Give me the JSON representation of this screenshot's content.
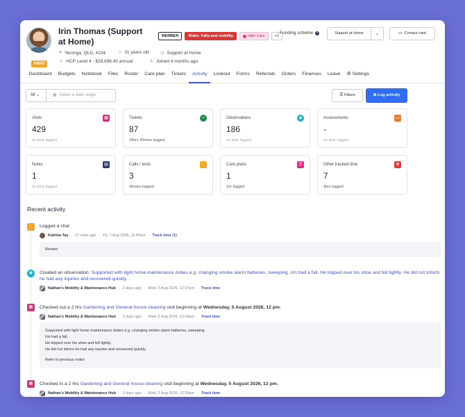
{
  "client": {
    "name": "Irin Thomas (Support at Home)",
    "status": "AWAY",
    "badges": {
      "member": "MEMBER",
      "risk": "Risks: Falls and mobility",
      "care": "High Care",
      "more": "+2"
    },
    "location": "Yeronga, QLD, 4104",
    "age": "31 years old",
    "program": "Support at Home",
    "funding_level": "HCP Level 4 - $29,696.40 annual",
    "joined": "Joined 4 months ago"
  },
  "header": {
    "funding_label": "Funding scheme",
    "funding_value": "Support at Home",
    "contact_button": "Contact card"
  },
  "tabs": [
    "Dashboard",
    "Budgets",
    "Notebook",
    "Files",
    "Roster",
    "Care plan",
    "Tickets",
    "Activity",
    "Lookout",
    "Forms",
    "Referrals",
    "Orders",
    "Finances",
    "Leave",
    "Settings"
  ],
  "active_tab": "Activity",
  "filters": {
    "all_label": "All",
    "date_placeholder": "Select a date range",
    "filters_button": "Filters",
    "log_button": "Log activity"
  },
  "stats": [
    {
      "label": "Visits",
      "value": "429",
      "sub": "no time logged",
      "color": "#d6317a",
      "icon": "calendar-icon"
    },
    {
      "label": "Tickets",
      "value": "87",
      "sub": "18hrs 30mins logged",
      "color": "#1f8a4c",
      "icon": "check-icon"
    },
    {
      "label": "Observations",
      "value": "186",
      "sub": "no time logged",
      "color": "#13b3c4",
      "icon": "eye-icon"
    },
    {
      "label": "Assessments",
      "value": "-",
      "sub": "no time logged",
      "color": "#f07a2b",
      "icon": "folder-icon"
    },
    {
      "label": "Notes",
      "value": "1",
      "sub": "no time logged",
      "color": "#2b3a67",
      "icon": "note-icon"
    },
    {
      "label": "Calls / texts",
      "value": "3",
      "sub": "45mins logged",
      "color": "#f5a524",
      "icon": "chat-icon"
    },
    {
      "label": "Care plans",
      "value": "1",
      "sub": "1hr logged",
      "color": "#d6317a",
      "icon": "list-icon"
    },
    {
      "label": "Other tracked time",
      "value": "7",
      "sub": "3hrs logged",
      "color": "#e83a3a",
      "icon": "plus-icon"
    }
  ],
  "recent_title": "Recent activity",
  "activities": {
    "a1": {
      "title": "Logged a chat",
      "who": "Katrina Tay",
      "ago": "27 mins ago",
      "when": "Fri, 7 Aug 2026, 11:45am",
      "track": "Track time (1)",
      "box": "Review"
    },
    "a2": {
      "prefix": "Created an observation: ",
      "link": "Supported with light home maintenance duties e.g. changing smoke alarm batteries, sweeping. Irin had a fall. He tripped over his shoe and fell lightly. He did not inform he had any injuries and recovered quickly. .",
      "who": "Nathan's Mobility & Maintenance Hub",
      "ago": "2 days ago",
      "when": "Wed, 5 Aug 2026, 12:37pm",
      "track": "Track time"
    },
    "a3": {
      "prefix": "Checked out a 2 hrs ",
      "link": "Gardening and General house cleaning",
      "middle": " visit beginning at ",
      "bold": "Wednesday, 5 August 2026, 12 pm.",
      "who": "Nathan's Mobility & Maintenance Hub",
      "ago": "2 days ago",
      "when": "Wed, 5 Aug 2026, 12:36pm",
      "track": "Track time",
      "box_lines": [
        "Supported with light home maintenance duties e.g. changing smoke alarm batteries, sweeping.",
        "Irin had a fall.",
        "He tripped over his shoe and fell lightly.",
        "He did not inform he had any injuries and recovered quickly."
      ],
      "box_link": "Refer to previous notes"
    },
    "a4": {
      "prefix": "Checked in a 2 hrs ",
      "link": "Gardening and General house cleaning",
      "middle": " visit beginning at ",
      "bold": "Wednesday, 5 August 2026, 12 pm.",
      "who": "Nathan's Mobility & Maintenance Hub",
      "ago": "2 days ago",
      "when": "Wed, 5 Aug 2026, 12:35pm",
      "track": "Track time"
    }
  }
}
